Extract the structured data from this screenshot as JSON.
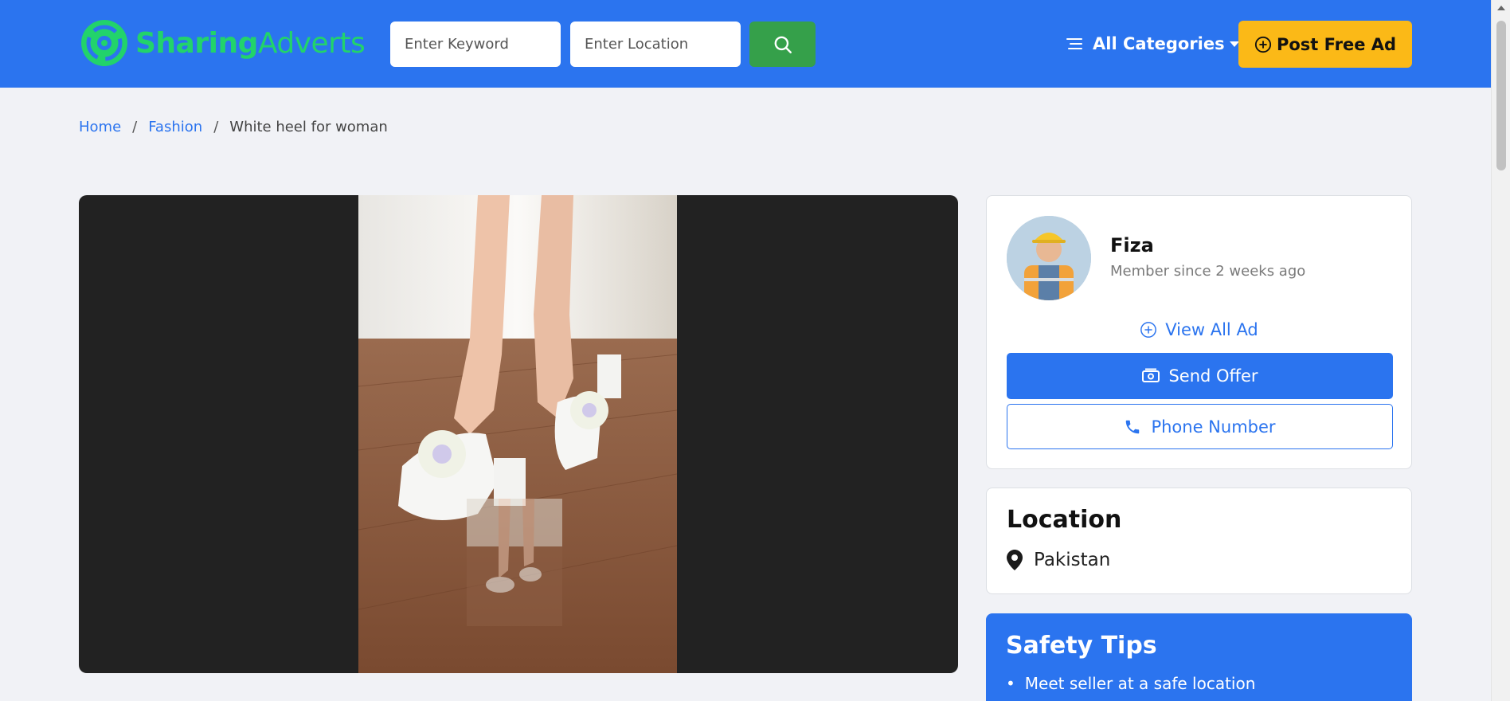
{
  "header": {
    "logo": {
      "part1": "Sharing",
      "part2": "Adverts"
    },
    "keyword_placeholder": "Enter Keyword",
    "location_placeholder": "Enter Location",
    "categories_label": "All Categories",
    "post_ad_label": "Post Free Ad"
  },
  "breadcrumb": {
    "home": "Home",
    "category": "Fashion",
    "current": "White heel for woman",
    "separator": "/"
  },
  "seller": {
    "name": "Fiza",
    "member_since": "Member since 2 weeks ago",
    "view_all_label": "View All Ad",
    "send_offer_label": "Send Offer",
    "phone_label": "Phone Number"
  },
  "location": {
    "title": "Location",
    "value": "Pakistan"
  },
  "safety": {
    "title": "Safety Tips",
    "tips": [
      "Meet seller at a safe location"
    ]
  },
  "colors": {
    "primary": "#2b74ef",
    "logo_green": "#22d36b",
    "search_green": "#35a04a",
    "post_yellow": "#fbb917",
    "background": "#f1f2f6"
  }
}
